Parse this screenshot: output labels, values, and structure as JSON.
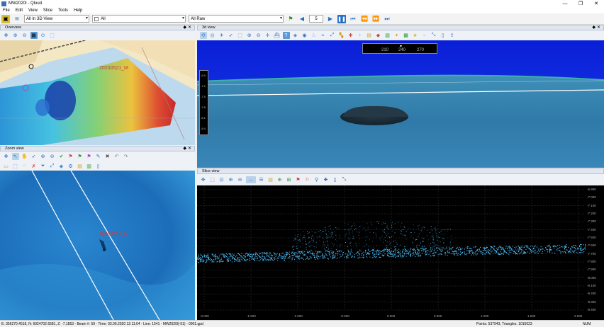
{
  "window": {
    "title": "MW2020I - Qloud"
  },
  "menu": [
    "File",
    "Edit",
    "View",
    "Slice",
    "Tools",
    "Help"
  ],
  "toolbar": {
    "view_combo": "All In 3D View",
    "filter_combo": "All",
    "data_combo": "All Raw",
    "step_value": "5"
  },
  "overview": {
    "title": "Overview",
    "label": "20200521_M"
  },
  "view3d": {
    "title": "3d view",
    "compass": [
      "210",
      "240",
      "270"
    ],
    "depth_ticks": [
      "-6.9",
      "-7.2",
      "-7.5",
      "-7.8",
      "-8.1",
      "-8.4"
    ]
  },
  "zoom": {
    "title": "Zoom view",
    "label": "20200521_M"
  },
  "slice": {
    "title": "Slice view",
    "y_ticks": [
      "-6.900",
      "-7.000",
      "-7.100",
      "-7.200",
      "-7.300",
      "-7.400",
      "-7.500",
      "-7.600",
      "-7.700",
      "-7.800",
      "-7.900",
      "-8.000",
      "-8.100",
      "-8.200",
      "-8.300",
      "-8.400"
    ],
    "x_ticks": [
      "-2.000",
      "-1.500",
      "-1.000",
      "-0.500",
      "0.000",
      "0.500",
      "1.000",
      "1.500",
      "2.000"
    ]
  },
  "status": {
    "coords": "E: 356270.4518, N: 6024702.6581, Z: -7.1853 - Beam #: 59 - Time: 03.06.2020 12:11:04 - Line: 1541 - MW2020l(-91) - 0001.gpd",
    "points": "Points: 537943, Triangles: 1015023",
    "num": "NUM"
  }
}
